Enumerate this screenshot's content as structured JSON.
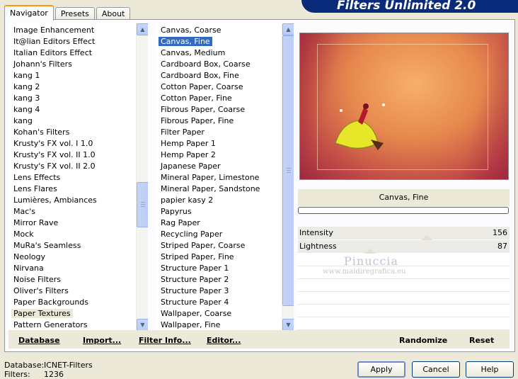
{
  "tabs": [
    "Navigator",
    "Presets",
    "About"
  ],
  "active_tab": 0,
  "header": {
    "title": "Filters Unlimited 2.0"
  },
  "categories": {
    "items": [
      "Image Enhancement",
      "It@lian Editors Effect",
      "Italian Editors Effect",
      "Johann's Filters",
      "kang 1",
      "kang 2",
      "kang 3",
      "kang 4",
      "kang",
      "Kohan's Filters",
      "Krusty's FX vol. I 1.0",
      "Krusty's FX vol. II 1.0",
      "Krusty's FX vol. II 2.0",
      "Lens Effects",
      "Lens Flares",
      "Lumières, Ambiances",
      "Mac's",
      "Mirror Rave",
      "Mock",
      "MuRa's Seamless",
      "Neology",
      "Nirvana",
      "Noise Filters",
      "Oliver's Filters",
      "Paper Backgrounds",
      "Paper Textures",
      "Pattern Generators"
    ],
    "highlighted": "Paper Textures"
  },
  "filters": {
    "items": [
      "Canvas, Coarse",
      "Canvas, Fine",
      "Canvas, Medium",
      "Cardboard Box, Coarse",
      "Cardboard Box, Fine",
      "Cotton Paper, Coarse",
      "Cotton Paper, Fine",
      "Fibrous Paper, Coarse",
      "Fibrous Paper, Fine",
      "Filter Paper",
      "Hemp Paper 1",
      "Hemp Paper 2",
      "Japanese Paper",
      "Mineral Paper, Limestone",
      "Mineral Paper, Sandstone",
      "papier kasy 2",
      "Papyrus",
      "Rag Paper",
      "Recycling Paper",
      "Striped Paper, Coarse",
      "Striped Paper, Fine",
      "Structure Paper 1",
      "Structure Paper 2",
      "Structure Paper 3",
      "Structure Paper 4",
      "Wallpaper, Coarse",
      "Wallpaper, Fine"
    ],
    "selected": "Canvas, Fine"
  },
  "preview": {
    "filter_name": "Canvas, Fine"
  },
  "params": [
    {
      "label": "Intensity",
      "value": "156"
    },
    {
      "label": "Lightness",
      "value": "87"
    }
  ],
  "watermark": {
    "name": "Pinuccia",
    "url": "www.maidiregrafica.eu"
  },
  "bottom_buttons": {
    "database": "Database",
    "import": "Import...",
    "filter_info": "Filter Info...",
    "editor": "Editor...",
    "randomize": "Randomize",
    "reset": "Reset"
  },
  "status": {
    "database_label": "Database:",
    "database_value": "ICNET-Filters",
    "filters_label": "Filters:",
    "filters_value": "1236"
  },
  "dialog_buttons": {
    "apply": "Apply",
    "cancel": "Cancel",
    "help": "Help"
  },
  "colors": {
    "selection": "#316ac5",
    "header": "#0a2a7a",
    "tab_accent": "#ff9900"
  }
}
